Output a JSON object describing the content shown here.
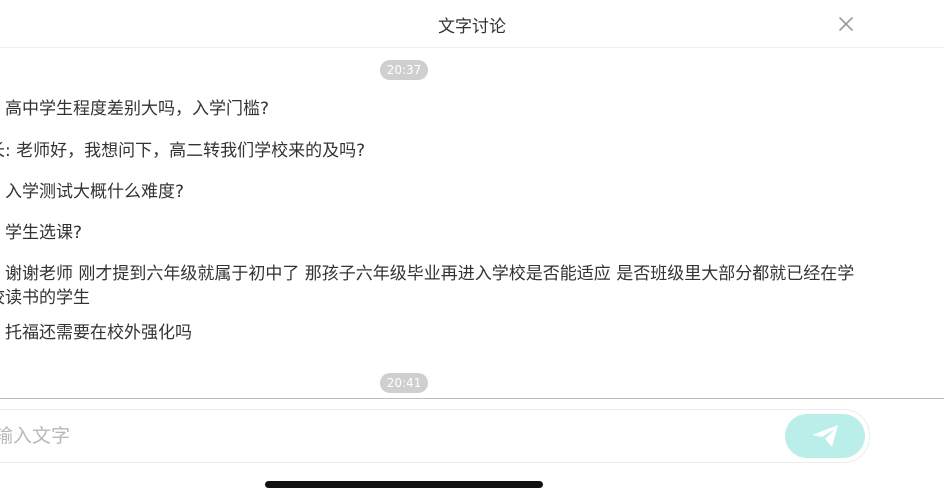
{
  "header": {
    "title": "文字讨论"
  },
  "messages": {
    "time_1": "20:37",
    "items": [
      "、高中学生程度差别大吗，入学门槛?",
      "长: 老师好，我想问下，高二转我们学校来的及吗?",
      "、入学测试大概什么难度?",
      "、学生选课?",
      "、谢谢老师 刚才提到六年级就属于初中了 那孩子六年级毕业再进入学校是否能适应 是否班级里大部分都就已经在学校读书的学生",
      "、托福还需要在校外强化吗"
    ],
    "time_2": "20:41"
  },
  "input": {
    "placeholder": "这输入文字",
    "value": ""
  },
  "colors": {
    "send_button_bg": "#b9eee9",
    "send_icon": "#ffffff",
    "time_pill_bg": "#cfcfcf"
  },
  "icons": {
    "close": "close-icon",
    "send": "paper-plane-icon"
  }
}
